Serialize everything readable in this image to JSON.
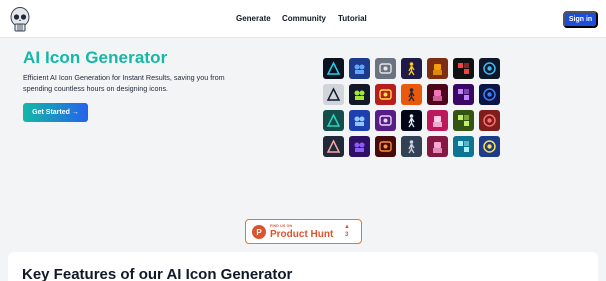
{
  "nav": {
    "generate": "Generate",
    "community": "Community",
    "tutorial": "Tutorial",
    "sign_in": "Sign in"
  },
  "hero": {
    "title": "AI Icon Generator",
    "subtitle": "Efficient AI Icon Generation for Instant Results, saving you from spending countless hours on designing icons.",
    "cta": "Get Started →"
  },
  "gallery": [
    {
      "name": "neon-pyramid-icon",
      "bg": "#0b1220",
      "fg": "#22d3ee"
    },
    {
      "name": "robot-crowd-icon",
      "bg": "#1e3a8a",
      "fg": "#60a5fa"
    },
    {
      "name": "game-console-icon",
      "bg": "#6b7280",
      "fg": "#e5e7eb"
    },
    {
      "name": "running-figure-icon",
      "bg": "#1e1b4b",
      "fg": "#facc15"
    },
    {
      "name": "gold-robot-icon",
      "bg": "#7c2d12",
      "fg": "#f59e0b"
    },
    {
      "name": "red-grid-icon",
      "bg": "#111111",
      "fg": "#ef4444"
    },
    {
      "name": "blue-eye-icon",
      "bg": "#0f172a",
      "fg": "#38bdf8"
    },
    {
      "name": "blaster-icon",
      "bg": "#d1d5db",
      "fg": "#111827"
    },
    {
      "name": "alien-icon",
      "bg": "#111827",
      "fg": "#a3e635"
    },
    {
      "name": "retro-party-icon",
      "bg": "#b91c1c",
      "fg": "#fde047"
    },
    {
      "name": "sunset-city-icon",
      "bg": "#ea580c",
      "fg": "#1f2937"
    },
    {
      "name": "pink-ghost-icon",
      "bg": "#4c0519",
      "fg": "#f472b6"
    },
    {
      "name": "mage-icon",
      "bg": "#3b0764",
      "fg": "#c084fc"
    },
    {
      "name": "capsule-icon",
      "bg": "#0c1445",
      "fg": "#3b82f6"
    },
    {
      "name": "teal-mask-icon",
      "bg": "#134e4a",
      "fg": "#2dd4bf"
    },
    {
      "name": "blue-face-icon",
      "bg": "#1e40af",
      "fg": "#93c5fd"
    },
    {
      "name": "purple-nx-icon",
      "bg": "#581c87",
      "fg": "#e9d5ff"
    },
    {
      "name": "sword-icon",
      "bg": "#020617",
      "fg": "#e2e8f0"
    },
    {
      "name": "kid-portrait-icon",
      "bg": "#be185d",
      "fg": "#fbcfe8"
    },
    {
      "name": "green-monster-icon",
      "bg": "#365314",
      "fg": "#bef264"
    },
    {
      "name": "red-tile-icon",
      "bg": "#7f1d1d",
      "fg": "#f87171"
    },
    {
      "name": "tiny-robot-icon",
      "bg": "#1f2937",
      "fg": "#fca5a5"
    },
    {
      "name": "purple-gem-icon",
      "bg": "#2e1065",
      "fg": "#8b5cf6"
    },
    {
      "name": "ice-fire-icon",
      "bg": "#450a0a",
      "fg": "#fb923c"
    },
    {
      "name": "stone-orb-icon",
      "bg": "#334155",
      "fg": "#cbd5e1"
    },
    {
      "name": "magenta-block-icon",
      "bg": "#831843",
      "fg": "#f9a8d4"
    },
    {
      "name": "blue-blob-icon",
      "bg": "#0e7490",
      "fg": "#a5f3fc"
    },
    {
      "name": "yellow-critter-icon",
      "bg": "#1e3a8a",
      "fg": "#fde047"
    }
  ],
  "product_hunt": {
    "small": "FIND US ON",
    "name": "Product Hunt",
    "arrow": "▲",
    "count": "3"
  },
  "features": {
    "title": "Key Features of our AI Icon Generator"
  }
}
